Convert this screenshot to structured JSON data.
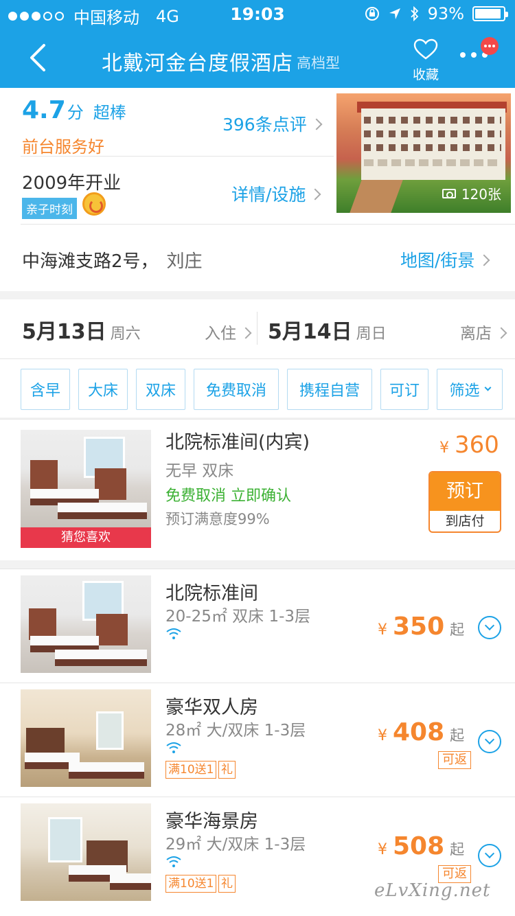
{
  "status_bar": {
    "carrier": "中国移动",
    "network": "4G",
    "time": "19:03",
    "battery": "93%",
    "battery_level": 0.93,
    "icons": [
      "orientation-lock-icon",
      "location-arrow-icon",
      "bluetooth-icon"
    ]
  },
  "nav": {
    "title": "北戴河金台度假酒店",
    "hotel_type": "高档型",
    "favorite_label": "收藏",
    "back_icon": "back-arrow-icon",
    "more_icon": "more-dots-icon"
  },
  "hotel": {
    "score": "4.7",
    "score_unit": "分",
    "score_word": "超棒",
    "tagline": "前台服务好",
    "reviews": "396条点评",
    "opened": "2009年开业",
    "family_tag": "亲子时刻",
    "facilities_link": "详情/设施",
    "photo_count": "120张",
    "address": "中海滩支路2号，",
    "area": "刘庄",
    "map_link": "地图/街景"
  },
  "dates": {
    "checkin_date": "5月13日",
    "checkin_weekday": "周六",
    "checkin_label": "入住",
    "checkout_date": "5月14日",
    "checkout_weekday": "周日",
    "checkout_label": "离店"
  },
  "filters": [
    "含早",
    "大床",
    "双床",
    "免费取消",
    "携程自营",
    "可订",
    "筛选"
  ],
  "featured_room": {
    "name": "北院标准间(内宾)",
    "meal_bed": "无早  双床",
    "policy": "免费取消  立即确认",
    "satisfaction": "预订满意度99%",
    "badge": "猜您喜欢",
    "currency": "¥",
    "price": "360",
    "book_label": "预订",
    "pay_label": "到店付"
  },
  "rooms": [
    {
      "name": "北院标准间",
      "details": "20-25㎡ 双床 1-3层",
      "currency": "¥",
      "price": "350",
      "suffix": "起",
      "promos": [],
      "refund": ""
    },
    {
      "name": "豪华双人房",
      "details": "28㎡ 大/双床 1-3层",
      "currency": "¥",
      "price": "408",
      "suffix": "起",
      "promos": [
        "满10送1",
        "礼"
      ],
      "refund": "可返"
    },
    {
      "name": "豪华海景房",
      "details": "29㎡ 大/双床 1-3层",
      "currency": "¥",
      "price": "508",
      "suffix": "起",
      "promos": [
        "满10送1",
        "礼"
      ],
      "refund": "可返"
    }
  ],
  "watermark": "eLvXing.net",
  "colors": {
    "brand_blue": "#1ca2e6",
    "orange": "#f5862e",
    "green": "#3cb134",
    "red_badge": "#e8384b"
  }
}
